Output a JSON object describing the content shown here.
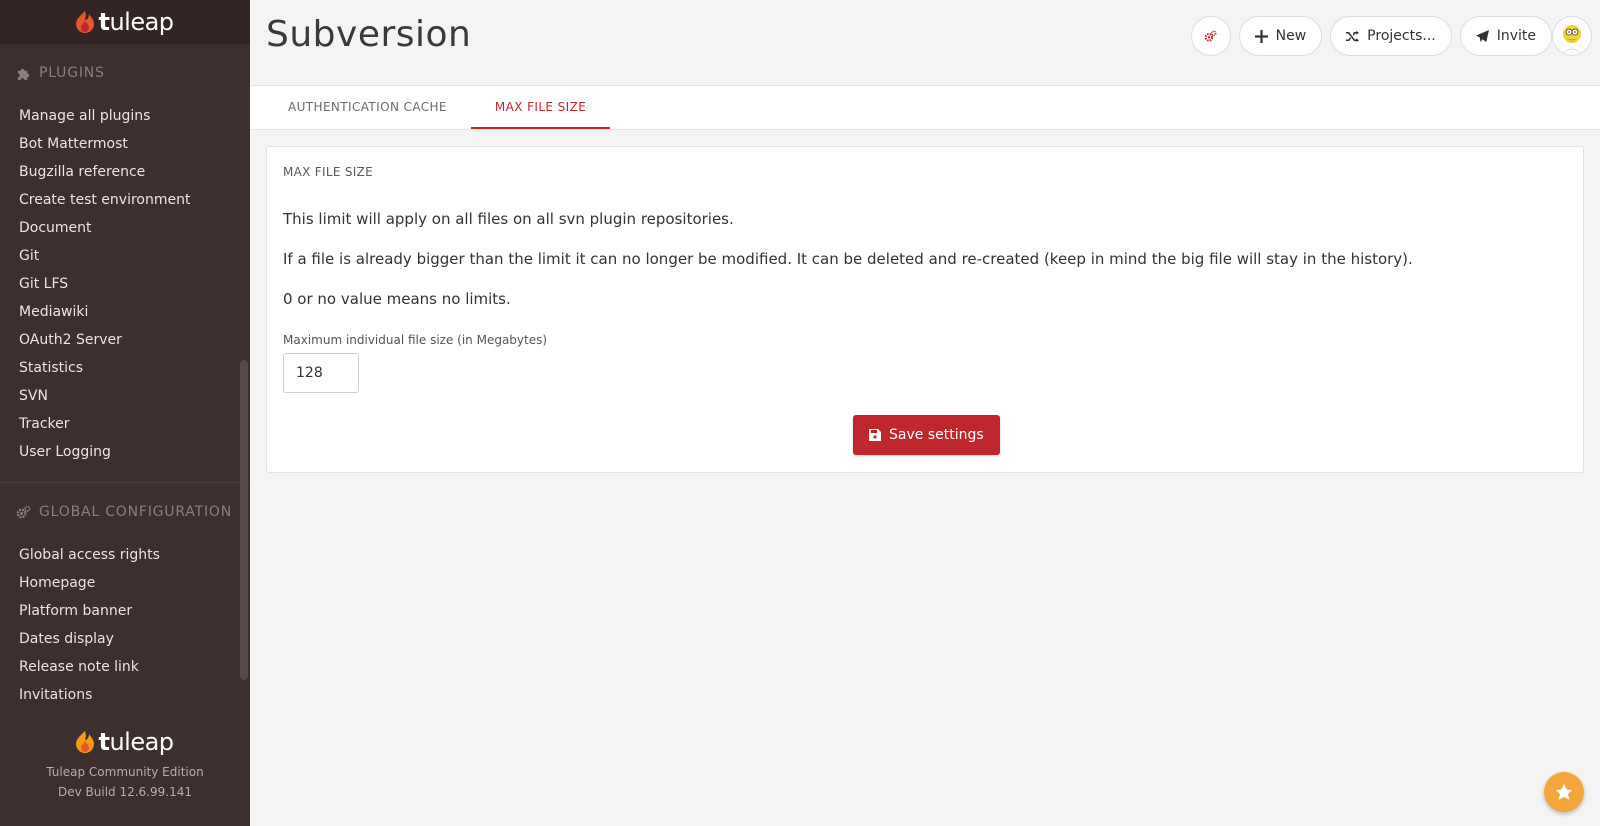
{
  "brand": {
    "logo_text_bold": "t",
    "logo_text_rest": "uleap",
    "edition": "Tuleap Community Edition",
    "build": "Dev Build 12.6.99.141",
    "accent_color": "#c0272d",
    "sidebar_bg": "#3c2f2e"
  },
  "sidebar": {
    "plugins_section": {
      "title": "PLUGINS",
      "icon": "puzzle-icon",
      "items": [
        {
          "label": "Manage all plugins"
        },
        {
          "label": "Bot Mattermost"
        },
        {
          "label": "Bugzilla reference"
        },
        {
          "label": "Create test environment"
        },
        {
          "label": "Document"
        },
        {
          "label": "Git"
        },
        {
          "label": "Git LFS"
        },
        {
          "label": "Mediawiki"
        },
        {
          "label": "OAuth2 Server"
        },
        {
          "label": "Statistics"
        },
        {
          "label": "SVN"
        },
        {
          "label": "Tracker"
        },
        {
          "label": "User Logging"
        }
      ]
    },
    "global_section": {
      "title": "GLOBAL CONFIGURATION",
      "icon": "cogs-icon",
      "items": [
        {
          "label": "Global access rights"
        },
        {
          "label": "Homepage"
        },
        {
          "label": "Platform banner"
        },
        {
          "label": "Dates display"
        },
        {
          "label": "Release note link"
        },
        {
          "label": "Invitations"
        }
      ]
    }
  },
  "header": {
    "title": "Subversion",
    "new_label": "New",
    "projects_label": "Projects...",
    "invite_label": "Invite"
  },
  "tabs": [
    {
      "label": "AUTHENTICATION CACHE",
      "active": false
    },
    {
      "label": "MAX FILE SIZE",
      "active": true
    }
  ],
  "pane": {
    "title": "MAX FILE SIZE",
    "paragraph_1": "This limit will apply on all files on all svn plugin repositories.",
    "paragraph_2": "If a file is already bigger than the limit it can no longer be modified. It can be deleted and re-created (keep in mind the big file will stay in the history).",
    "paragraph_3": "0 or no value means no limits.",
    "field_label": "Maximum individual file size (in Megabytes)",
    "field_value": "128",
    "save_label": "Save settings"
  }
}
